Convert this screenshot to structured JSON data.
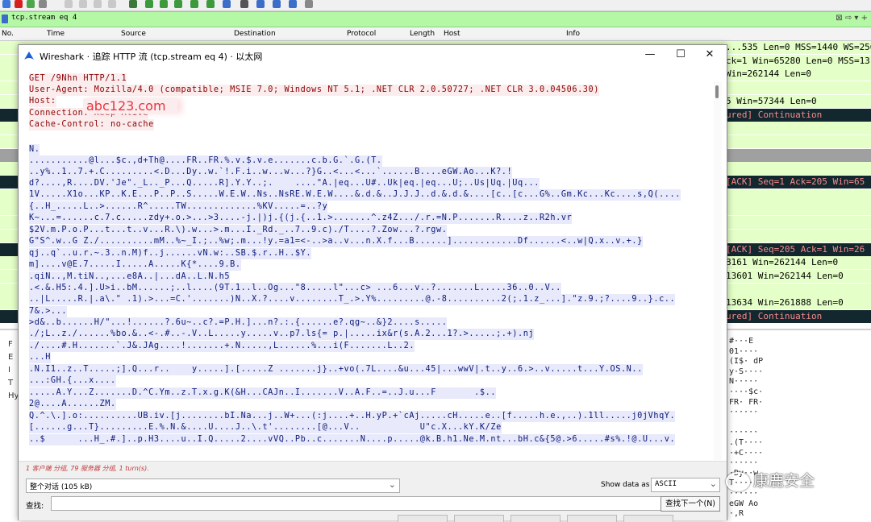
{
  "filter": {
    "value": "tcp.stream eq 4",
    "buttons": "⊠ ⇨ ▾ +"
  },
  "columns": [
    "No.",
    "Time",
    "Source",
    "Destination",
    "Protocol",
    "Length",
    "Host",
    "Info"
  ],
  "packet_info": [
    {
      "text": "...535 Len=0 MSS=1440 WS=256 SA",
      "bg": "#e4ffc7"
    },
    {
      "text": "ck=1 Win=65280 Len=0 MSS=13",
      "bg": "#e4ffc7"
    },
    {
      "text": "Win=262144 Len=0",
      "bg": "#e4ffc7"
    },
    {
      "text": "",
      "bg": "#e4ffc7"
    },
    {
      "text": "5 Win=57344 Len=0",
      "bg": "#e4ffc7"
    },
    {
      "text": "ured] Continuation",
      "bg": "#12272e",
      "fg": "#f78b8b"
    },
    {
      "text": "",
      "bg": "#e4ffc7"
    },
    {
      "text": "",
      "bg": "#e4ffc7"
    },
    {
      "text": "",
      "bg": "#a0a0a0"
    },
    {
      "text": "",
      "bg": "#e4ffc7"
    },
    {
      "text": "[ACK] Seq=1 Ack=205 Win=65",
      "bg": "#12272e",
      "fg": "#f78b8b"
    },
    {
      "text": "",
      "bg": "#e4ffc7"
    },
    {
      "text": "",
      "bg": "#e4ffc7"
    },
    {
      "text": "",
      "bg": "#e4ffc7"
    },
    {
      "text": "",
      "bg": "#e4ffc7"
    },
    {
      "text": "[ACK] Seq=205 Ack=1 Win=26",
      "bg": "#12272e",
      "fg": "#f78b8b"
    },
    {
      "text": "8161 Win=262144 Len=0",
      "bg": "#e4ffc7"
    },
    {
      "text": "13601 Win=262144 Len=0",
      "bg": "#e4ffc7"
    },
    {
      "text": "",
      "bg": "#e4ffc7"
    },
    {
      "text": "13634 Win=261888 Len=0",
      "bg": "#e4ffc7"
    },
    {
      "text": "ured] Continuation",
      "bg": "#12272e",
      "fg": "#f78b8b"
    }
  ],
  "details": [
    "F",
    "E",
    "I",
    "T",
    "Hy"
  ],
  "hex": [
    "#···E",
    "01····",
    "(I$· dP",
    "y·S····",
    "N·····",
    "····$c·",
    "FR· FR·",
    "······",
    "",
    "······",
    ".(T····",
    "·+C····",
    "······",
    "·Dy··w",
    "T·····",
    "······",
    "eGW Ao",
    "·,R"
  ],
  "dialog": {
    "title": "Wireshark · 追踪 HTTP 流 (tcp.stream eq 4) · 以太网",
    "minimize": "—",
    "maximize": "☐",
    "close": "✕"
  },
  "host_value": "abc123.com",
  "stream_lines": [
    {
      "t": "GET /9Nhn HTTP/1.1",
      "c": "cl"
    },
    {
      "t": "User-Agent: Mozilla/4.0 (compatible; MSIE 7.0; Windows NT 5.1; .NET CLR 2.0.50727; .NET CLR 3.0.04506.30)",
      "c": "cl"
    },
    {
      "t": "Host:",
      "c": "cl"
    },
    {
      "t": "Connection: Keep-Alive",
      "c": "cl"
    },
    {
      "t": "Cache-Control: no-cache",
      "c": "cl"
    },
    {
      "t": "",
      "c": ""
    },
    {
      "t": "N.",
      "c": "sv"
    },
    {
      "t": "...........@l...$c.,d+Th@....FR..FR.%.v.$.v.e.......c.b.G.`.G.(T.",
      "c": "sv"
    },
    {
      "t": "..y%..1..7.+.C.........<.D...Dy..w.`!.F.i..w...w...?}G..<...<...`......B....eGW.Ao...K?.!",
      "c": "sv"
    },
    {
      "t": "d?....,R....DV.'Je\"._L.._P...Q.....R].Y.Y..;.    ....\"A.|eq...U#..Uk|eq.|eq...U;..Us|Uq.|Uq...",
      "c": "sv"
    },
    {
      "t": "1V.....X1o...KP..K.E...P..P..S.....W.E.W..Ns..NsRE.W.E.W....&.d.&..J.J.J..d.&.d.&....[c..[c...G%..Gm.Kc...Kc....s,Q(....",
      "c": "sv"
    },
    {
      "t": "{..H_.....L..>......R^.....TW.............%KV.....=..?y",
      "c": "sv"
    },
    {
      "t": "K~...=......c.7.c.....zdy+.o.>...>3....-j.|)j.{(j.{..1.>.......^.z4Z.../.r.=N.P.......R....z..R2h.vr",
      "c": "sv"
    },
    {
      "t": "$2V.m.P.o.P...t...t..v...R.\\).w...>.m...I._Rd._..7..9.c)./T....?.Zow...?.rgw.",
      "c": "sv"
    },
    {
      "t": "G\"S^.w..G Z./..........mM..%~_I.;..%w;.m...!y.=a1=<-..>a..v...n.X.f...B......]............Df......<..w|Q.x..v.+.}",
      "c": "sv"
    },
    {
      "t": "qj..q`..u.r.~.3..n.M)f..j......vN.w:..SB.$.r..H..$Y.",
      "c": "sv"
    },
    {
      "t": "m]....v@E.7.....I.....A.....K{*....9.B.",
      "c": "sv"
    },
    {
      "t": ".qiN..,M.tiN..,...e8A..|...dA..L.N.h5",
      "c": "sv"
    },
    {
      "t": ".<.&.H5:.4.].U>i..bM......;..l....(9T.1..l..Og...\"8.....l\"...c> ...6...v..?.......L.....36..0..V..",
      "c": "sv"
    },
    {
      "t": "..|L.....R.|.a\\.\" .1).>...=C.'.......)N..X.?....v........T_.>.Y%.........@.-8..........2(;.1.z_...].\"z.9.;?....9..}.c..",
      "c": "sv"
    },
    {
      "t": "7&.>...",
      "c": "sv"
    },
    {
      "t": ">d&..b......H/\"...!......?.6u~..c?.=P.H.]...n?.:.{......e?.qg~..&}2....s.....",
      "c": "sv"
    },
    {
      "t": "./;L..z./......%bo.&..<-.#..-.V..L.....y.....v..p7.ls{= p.|.....ix&r(s.A.2...1?.>.....;.+).nj",
      "c": "sv"
    },
    {
      "t": "./....#.H.......`.J&.JAg....!.......+.N.....,L......%...i(F.......L..2.",
      "c": "sv"
    },
    {
      "t": "...H",
      "c": "sv"
    },
    {
      "t": ".N.I1..z..T.....;].Q...r..    y.....].[.....Z .......j}..+vo(.7L....&u...45|...wwV|.t..y..6.>..v.....t...Y.OS.N..",
      "c": "sv"
    },
    {
      "t": "...:GH.{...x....",
      "c": "sv"
    },
    {
      "t": ".....A.Y...Z.......D.^C.Ym..z.T.x.g.K(&H...CAJn..I.......V..A.F..=..J.u...F       .$..",
      "c": "sv"
    },
    {
      "t": "2@....A......ZM.",
      "c": "sv"
    },
    {
      "t": "Q.^.\\.].o:..........UB.iv.[j........bI.Na...j..W+...(:j....+..H.yP.+`cAj.....cH.....e..[f.....h.e.,..).1ll.....j0jVhqY.",
      "c": "sv"
    },
    {
      "t": "[......g...T}.........E.%.N.&....U....J..\\.t'........[@...V..           U\"c.X...kY.K/Ze",
      "c": "sv"
    },
    {
      "t": "..$      ...H_.#.]..p.H3....u..I.Q.....2....vVQ..Pb..c.......N....p.....@k.B.h1.Ne.M.nt...bH.c&{5@.>6.....#s%.!@.U...v.",
      "c": "sv"
    }
  ],
  "bottom": {
    "summary": "1 客户端 分组, 79 服务器 分组, 1 turn(s).",
    "conversation": "整个对话 (105 kB)",
    "show_data_label": "Show data as",
    "show_data_value": "ASCII",
    "find_label": "查找:",
    "find_next": "查找下一个(N)"
  },
  "watermark": "康鹿安全",
  "colors": {
    "client_text": "#8b0000",
    "client_bg": "#fbedee",
    "server_text": "#0b1a7a",
    "server_bg": "#e8e9fa",
    "filter_bg": "#b4f7a5"
  }
}
